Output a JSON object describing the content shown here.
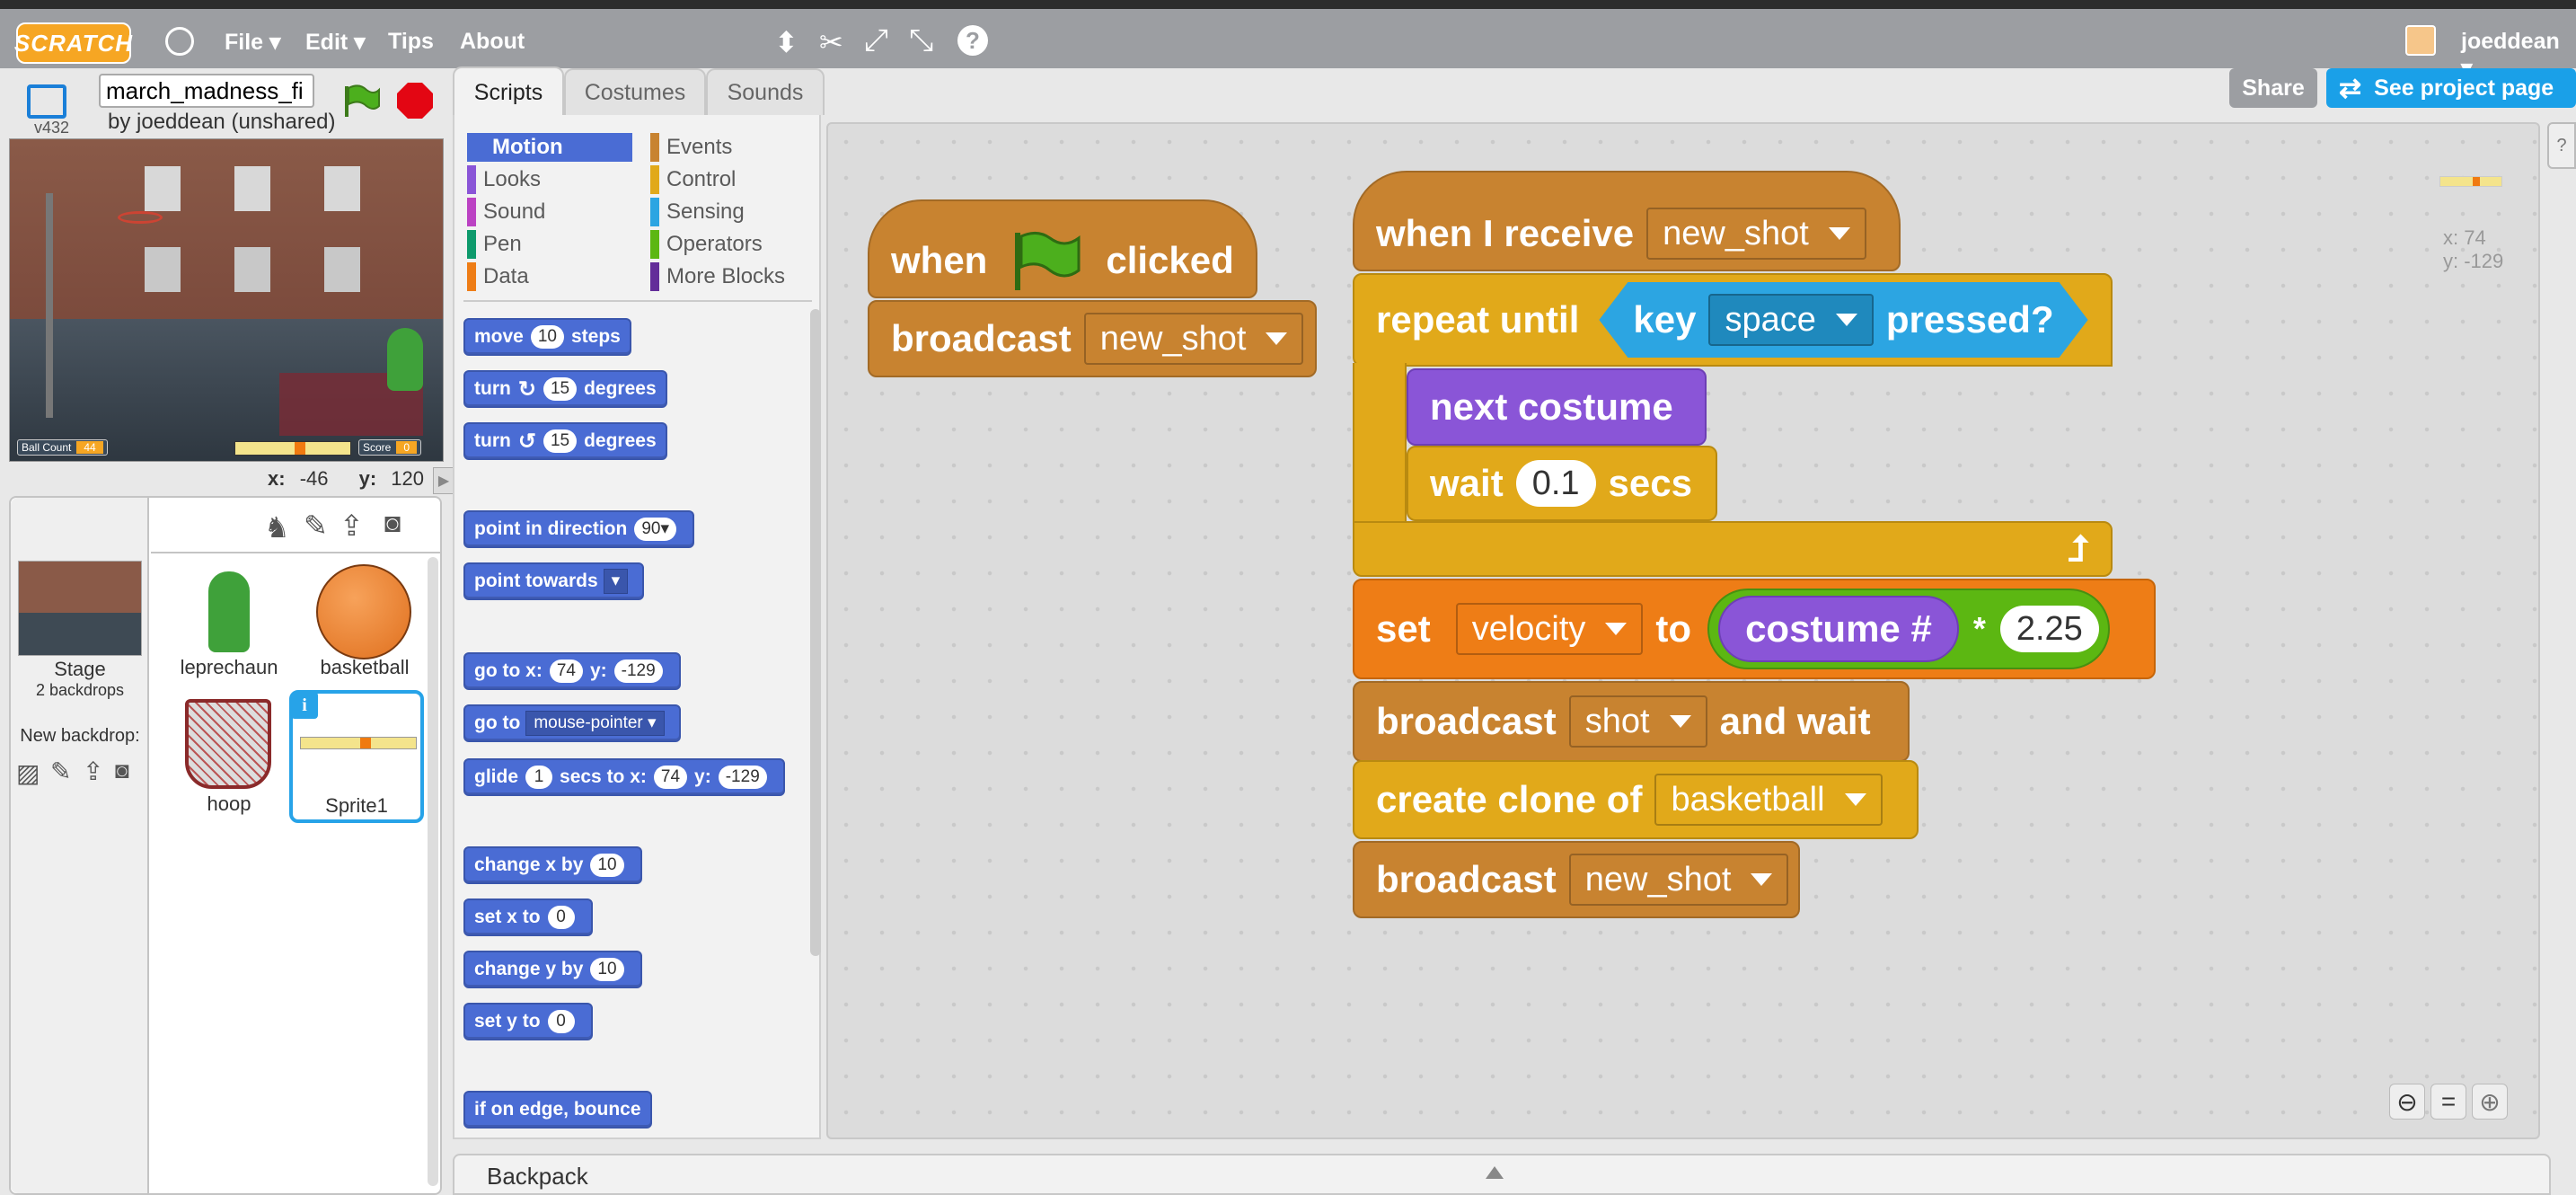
{
  "topbar": {
    "logo": "SCRATCH",
    "menu": [
      "File",
      "Edit",
      "Tips",
      "About"
    ],
    "username": "joeddean"
  },
  "stage": {
    "version": "v432",
    "project_title": "march_madness_fi",
    "author": "by joeddean (unshared)",
    "hud_ball_count_label": "Ball Count",
    "hud_ball_count_value": "44",
    "hud_score_label": "Score",
    "hud_score_value": "0",
    "coords_x_label": "x:",
    "coords_x": "-46",
    "coords_y_label": "y:",
    "coords_y": "120"
  },
  "sprites": {
    "stage_label": "Stage",
    "stage_sub": "2 backdrops",
    "new_backdrop": "New backdrop:",
    "items": [
      {
        "label": "leprechaun"
      },
      {
        "label": "basketball"
      },
      {
        "label": "hoop"
      },
      {
        "label": "Sprite1"
      }
    ]
  },
  "tabs": [
    "Scripts",
    "Costumes",
    "Sounds"
  ],
  "header_buttons": {
    "share": "Share",
    "see_project": "See project page"
  },
  "palette": {
    "categories_left": [
      "Motion",
      "Looks",
      "Sound",
      "Pen",
      "Data"
    ],
    "categories_right": [
      "Events",
      "Control",
      "Sensing",
      "Operators",
      "More Blocks"
    ],
    "colors": {
      "motion": "#4a6cd4",
      "looks": "#8a55d7",
      "sound": "#bb42c3",
      "pen": "#0e9a6c",
      "data": "#ee7d16",
      "events": "#c88330",
      "control": "#e1a91a",
      "sensing": "#2ca5e2",
      "operators": "#5cb712",
      "more": "#632d99"
    },
    "blocks": {
      "move_a": "move",
      "move_n": "10",
      "move_b": "steps",
      "turn_r_a": "turn",
      "turn_r_n": "15",
      "turn_r_b": "degrees",
      "turn_l_a": "turn",
      "turn_l_n": "15",
      "turn_l_b": "degrees",
      "point_dir": "point in direction",
      "point_dir_n": "90▾",
      "point_towards": "point towards",
      "goto_a": "go to x:",
      "goto_x": "74",
      "goto_b": "y:",
      "goto_y": "-129",
      "goto_mp": "go to",
      "goto_mp_dd": "mouse-pointer",
      "glide_a": "glide",
      "glide_n": "1",
      "glide_b": "secs to x:",
      "glide_x": "74",
      "glide_c": "y:",
      "glide_y": "-129",
      "chx_a": "change x by",
      "chx_n": "10",
      "setx_a": "set x to",
      "setx_n": "0",
      "chy_a": "change y by",
      "chy_n": "10",
      "sety_a": "set y to",
      "sety_n": "0",
      "bounce": "if on edge, bounce"
    }
  },
  "scripts": {
    "s1": {
      "when": "when",
      "clicked": "clicked",
      "broadcast": "broadcast",
      "broadcast_msg": "new_shot"
    },
    "s2": {
      "when_receive": "when I receive",
      "receive_msg": "new_shot",
      "repeat_until": "repeat until",
      "key": "key",
      "key_name": "space",
      "pressed": "pressed?",
      "next_costume": "next costume",
      "wait": "wait",
      "wait_n": "0.1",
      "secs": "secs",
      "set": "set",
      "set_var": "velocity",
      "to": "to",
      "costume": "costume #",
      "times": "*",
      "mult": "2.25",
      "bcw": "broadcast",
      "bcw_msg": "shot",
      "and_wait": "and wait",
      "create_clone": "create clone of",
      "clone_target": "basketball",
      "broadcast2": "broadcast",
      "broadcast2_msg": "new_shot"
    },
    "mouse_x": "x: 74",
    "mouse_y": "y: -129"
  },
  "backpack": "Backpack"
}
